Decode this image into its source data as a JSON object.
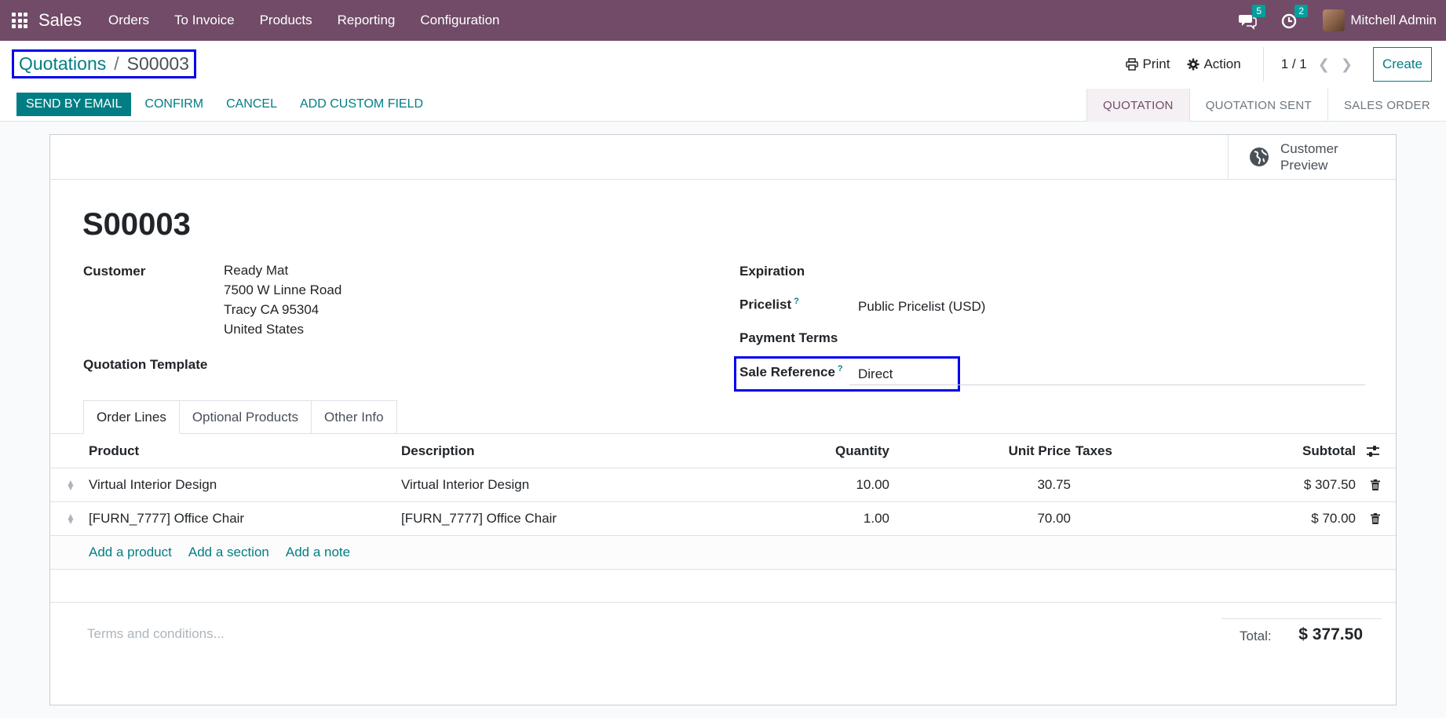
{
  "navbar": {
    "app_name": "Sales",
    "menus": [
      "Orders",
      "To Invoice",
      "Products",
      "Reporting",
      "Configuration"
    ],
    "messages_count": "5",
    "activities_count": "2",
    "user_name": "Mitchell Admin"
  },
  "breadcrumb": {
    "parent": "Quotations",
    "separator": "/",
    "current": "S00003"
  },
  "toolbar": {
    "print_label": "Print",
    "action_label": "Action",
    "pager": "1 / 1",
    "create_label": "Create"
  },
  "buttons": {
    "send_by_email": "SEND BY EMAIL",
    "confirm": "CONFIRM",
    "cancel": "CANCEL",
    "add_custom_field": "ADD CUSTOM FIELD"
  },
  "stages": [
    "QUOTATION",
    "QUOTATION SENT",
    "SALES ORDER"
  ],
  "customer_preview": "Customer Preview",
  "record": {
    "name": "S00003",
    "customer_label": "Customer",
    "customer_name": "Ready Mat",
    "customer_address": [
      "7500 W Linne Road",
      "Tracy CA 95304",
      "United States"
    ],
    "quotation_template_label": "Quotation Template",
    "expiration_label": "Expiration",
    "pricelist_label": "Pricelist",
    "pricelist_value": "Public Pricelist (USD)",
    "payment_terms_label": "Payment Terms",
    "sale_reference_label": "Sale Reference",
    "sale_reference_value": "Direct",
    "help_mark": "?"
  },
  "tabs": [
    "Order Lines",
    "Optional Products",
    "Other Info"
  ],
  "order_lines": {
    "headers": {
      "product": "Product",
      "description": "Description",
      "quantity": "Quantity",
      "unit_price": "Unit Price",
      "taxes": "Taxes",
      "subtotal": "Subtotal"
    },
    "rows": [
      {
        "product": "Virtual Interior Design",
        "description": "Virtual Interior Design",
        "quantity": "10.00",
        "unit_price": "30.75",
        "taxes": "",
        "subtotal": "$ 307.50"
      },
      {
        "product": "[FURN_7777] Office Chair",
        "description": "[FURN_7777] Office Chair",
        "quantity": "1.00",
        "unit_price": "70.00",
        "taxes": "",
        "subtotal": "$ 70.00"
      }
    ],
    "add_links": [
      "Add a product",
      "Add a section",
      "Add a note"
    ]
  },
  "footer": {
    "terms_placeholder": "Terms and conditions...",
    "total_label": "Total:",
    "total_value": "$ 377.50"
  },
  "colors": {
    "navbar": "#714b67",
    "accent": "#017e84",
    "highlight_box": "#0000ee"
  }
}
